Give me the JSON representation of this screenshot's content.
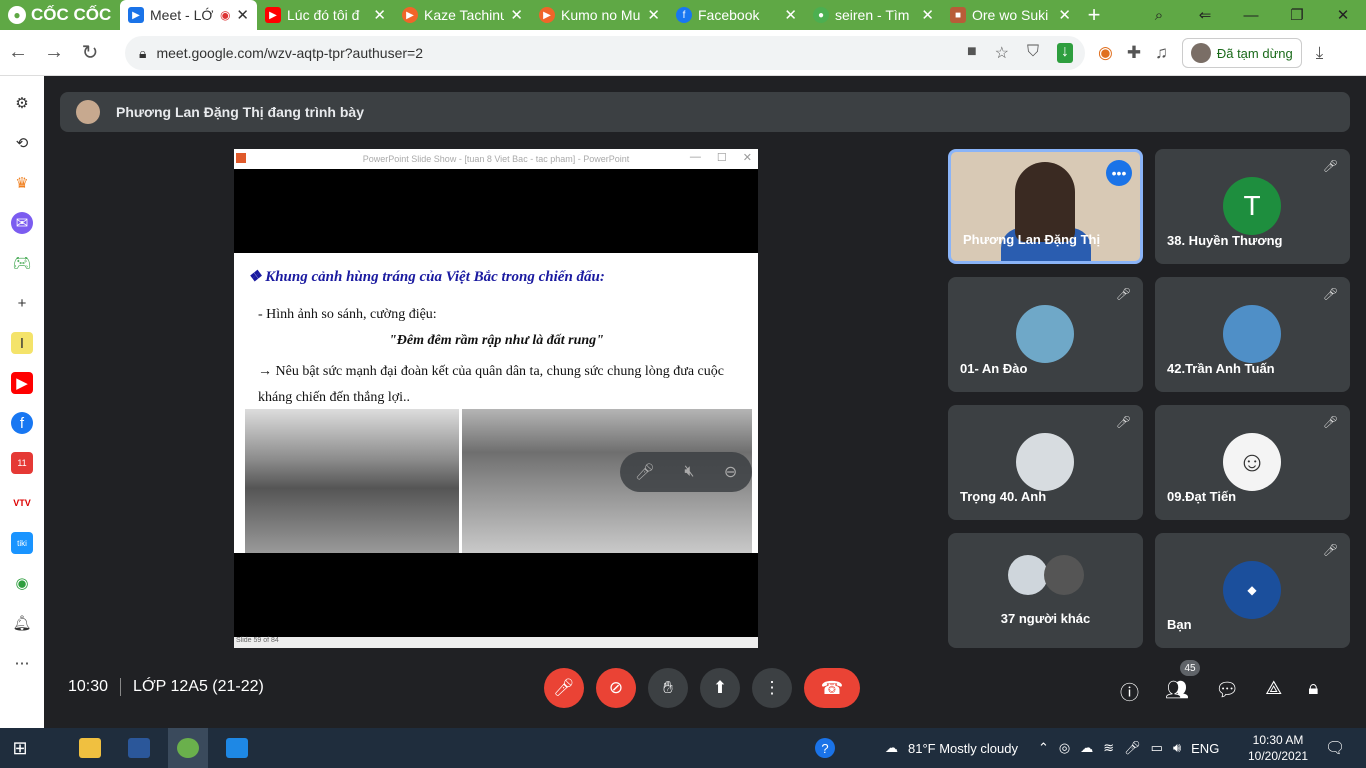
{
  "browser": {
    "brand": "CỐC CỐC",
    "tabs": [
      {
        "title": "Meet - LỚ",
        "fav_color": "#1a73e8",
        "active": true
      },
      {
        "title": "Lúc đó tôi đ",
        "fav_color": "#ff0000"
      },
      {
        "title": "Kaze Tachinu",
        "fav_color": "#f06529"
      },
      {
        "title": "Kumo no Mu",
        "fav_color": "#f06529"
      },
      {
        "title": "Facebook",
        "fav_color": "#1877f2"
      },
      {
        "title": "seiren - Tìm",
        "fav_color": "#4caf50"
      },
      {
        "title": "Ore wo Suki",
        "fav_color": "#b85c38"
      }
    ],
    "url": "meet.google.com/wzv-aqtp-tpr?authuser=2",
    "paused_label": "Đã tạm dừng"
  },
  "meet": {
    "presenter_banner": "Phương Lan Đặng Thị đang trình bày",
    "slide": {
      "window_title": "PowerPoint Slide Show - [tuan 8 Viet Bac - tac pham] - PowerPoint",
      "heading": "❖  Khung cảnh hùng tráng của Việt Bắc trong chiến đấu:",
      "line1": "- Hình ảnh so sánh, cường điệu:",
      "quote": "\"Đêm đêm rầm rập như là đất rung\"",
      "line2": "→ Nêu bật sức mạnh đại đoàn kết của quân dân ta, chung sức chung lòng đưa cuộc kháng chiến đến thắng lợi..",
      "status": "Slide 59 of 84"
    },
    "participants": [
      {
        "name": "Phương Lan Đặng Thị"
      },
      {
        "name": "38. Huyền Thương",
        "initial": "T",
        "color": "#1e8e3e"
      },
      {
        "name": "01- An Đào",
        "color": "#6fa8c8"
      },
      {
        "name": "42.Trần Anh Tuấn",
        "color": "#4f8fc7"
      },
      {
        "name": "Trọng 40. Anh",
        "color": "#d7dce0"
      },
      {
        "name": "09.Đạt Tiến",
        "color": "#f4f4f4"
      },
      {
        "name": "37 người khác"
      },
      {
        "name": "Bạn",
        "color": "#1b4f9c"
      }
    ],
    "meeting_time": "10:30",
    "meeting_name": "LỚP 12A5 (21-22)",
    "people_count": "45"
  },
  "taskbar": {
    "weather": "81°F  Mostly cloudy",
    "language": "ENG",
    "time": "10:30 AM",
    "date": "10/20/2021"
  }
}
